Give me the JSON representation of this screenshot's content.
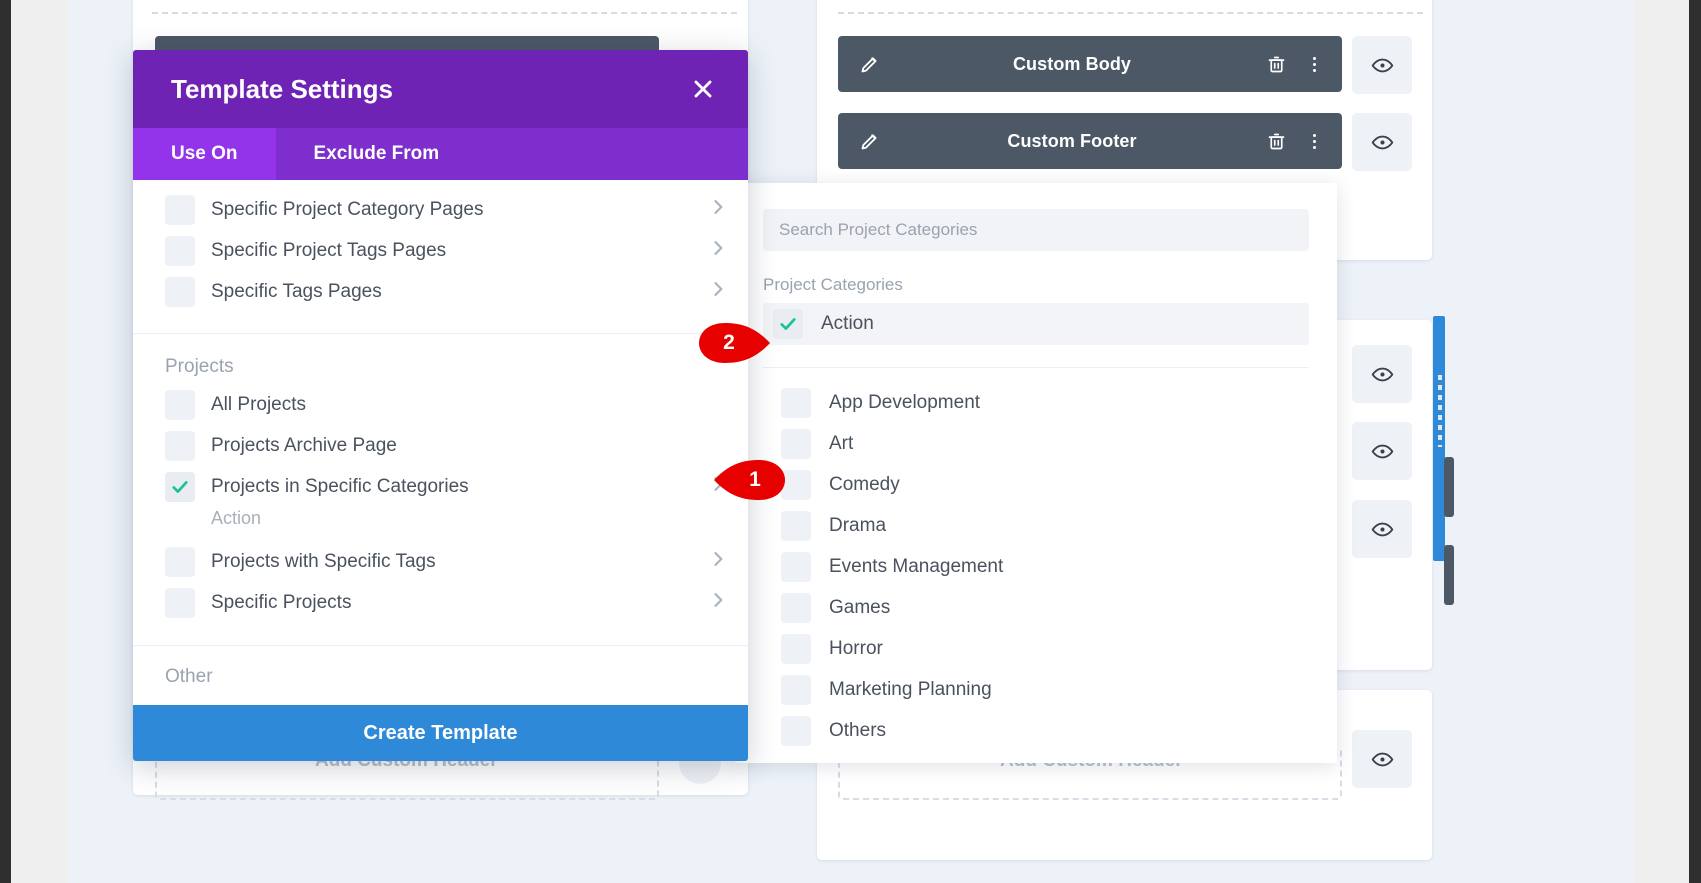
{
  "background": {
    "modules": [
      {
        "title": "Custom Body"
      },
      {
        "title": "Custom Footer"
      }
    ],
    "ghost_texts": [
      {
        "text": "Add Custom Header"
      },
      {
        "text": "Add Custom Header"
      }
    ]
  },
  "modal": {
    "title": "Template Settings",
    "close_label": "✕",
    "tabs": [
      {
        "label": "Use On",
        "active": true
      },
      {
        "label": "Exclude From",
        "active": false
      }
    ],
    "top_rows": [
      {
        "label": "Specific Project Category Pages",
        "checked": false,
        "chevron": true
      },
      {
        "label": "Specific Project Tags Pages",
        "checked": false,
        "chevron": true
      },
      {
        "label": "Specific Tags Pages",
        "checked": false,
        "chevron": true
      }
    ],
    "projects_section": {
      "title": "Projects",
      "rows": [
        {
          "label": "All Projects",
          "checked": false,
          "chevron": false
        },
        {
          "label": "Projects Archive Page",
          "checked": false,
          "chevron": false
        },
        {
          "label": "Projects in Specific Categories",
          "checked": true,
          "chevron": true,
          "note": "Action"
        },
        {
          "label": "Projects with Specific Tags",
          "checked": false,
          "chevron": true
        },
        {
          "label": "Specific Projects",
          "checked": false,
          "chevron": true
        }
      ]
    },
    "other_section": {
      "title": "Other"
    },
    "create_button": "Create Template"
  },
  "dropdown": {
    "search_placeholder": "Search Project Categories",
    "search_value": "",
    "group_label": "Project Categories",
    "selected": {
      "label": "Action",
      "checked": true
    },
    "items": [
      {
        "label": "App Development",
        "checked": false
      },
      {
        "label": "Art",
        "checked": false
      },
      {
        "label": "Comedy",
        "checked": false
      },
      {
        "label": "Drama",
        "checked": false
      },
      {
        "label": "Events Management",
        "checked": false
      },
      {
        "label": "Games",
        "checked": false
      },
      {
        "label": "Horror",
        "checked": false
      },
      {
        "label": "Marketing Planning",
        "checked": false
      },
      {
        "label": "Others",
        "checked": false
      }
    ]
  },
  "annotations": [
    {
      "number": "1",
      "direction": "left"
    },
    {
      "number": "2",
      "direction": "right"
    }
  ],
  "colors": {
    "modal_header": "#6f23b5",
    "tab_active": "#9333ea",
    "tab_bar": "#7e2ecc",
    "primary_button": "#2e8ad8",
    "module_bar": "#4c5866",
    "check_green": "#18c39a",
    "pin_red": "#e60000"
  }
}
